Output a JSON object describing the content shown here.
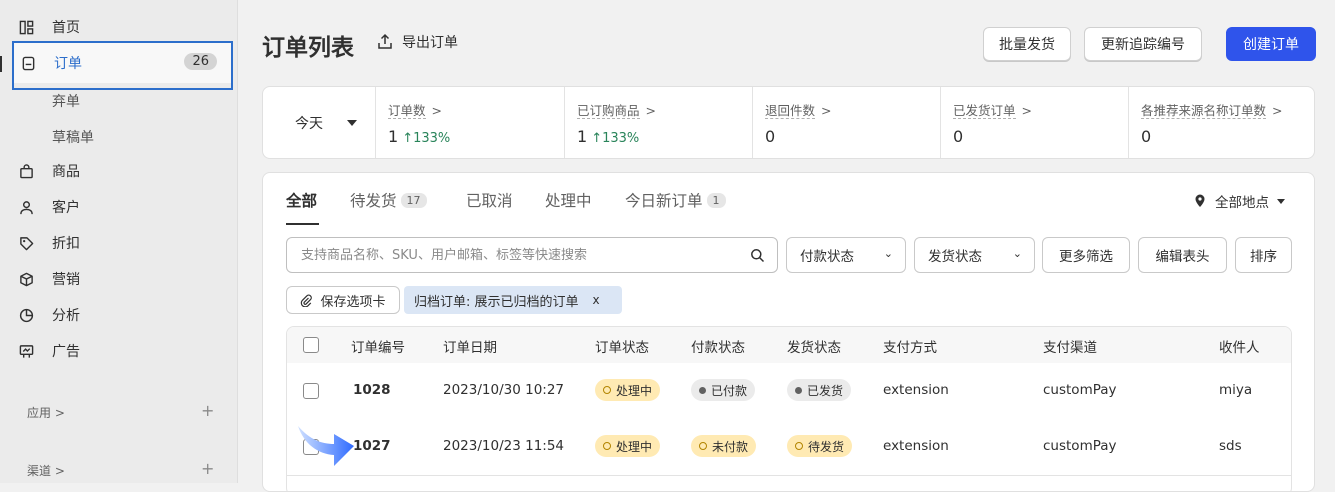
{
  "sidebar": {
    "home": "首页",
    "orders": "订单",
    "orders_count": "26",
    "abandoned": "弃单",
    "drafts": "草稿单",
    "products": "商品",
    "customers": "客户",
    "discounts": "折扣",
    "marketing": "营销",
    "analytics": "分析",
    "ads": "广告",
    "apps": "应用 >",
    "channels": "渠道 >"
  },
  "header": {
    "title": "订单列表",
    "export": "导出订单",
    "bulk_ship": "批量发货",
    "update_tracking": "更新追踪编号",
    "create_order": "创建订单"
  },
  "stats": {
    "period": "今天",
    "items": [
      {
        "label": "订单数",
        "value": "1",
        "delta": "133%"
      },
      {
        "label": "已订购商品",
        "value": "1",
        "delta": "133%"
      },
      {
        "label": "退回件数",
        "value": "0",
        "delta": ""
      },
      {
        "label": "已发货订单",
        "value": "0",
        "delta": ""
      },
      {
        "label": "各推荐来源名称订单数",
        "value": "0",
        "delta": ""
      }
    ]
  },
  "tabs": [
    {
      "label": "全部",
      "count": ""
    },
    {
      "label": "待发货",
      "count": "17"
    },
    {
      "label": "已取消",
      "count": ""
    },
    {
      "label": "处理中",
      "count": ""
    },
    {
      "label": "今日新订单",
      "count": "1"
    }
  ],
  "location": "全部地点",
  "filters": {
    "search_placeholder": "支持商品名称、SKU、用户邮箱、标签等快速搜索",
    "payment_status": "付款状态",
    "shipping_status": "发货状态",
    "more_filters": "更多筛选",
    "edit_columns": "编辑表头",
    "sort": "排序",
    "save_tab": "保存选项卡",
    "active_filter": "归档订单: 展示已归档的订单",
    "remove": "x"
  },
  "table": {
    "columns": [
      "订单编号",
      "订单日期",
      "订单状态",
      "付款状态",
      "发货状态",
      "支付方式",
      "支付渠道",
      "收件人"
    ],
    "rows": [
      {
        "id": "1028",
        "date": "2023/10/30 10:27",
        "order_status": "处理中",
        "payment": "已付款",
        "shipping": "已发货",
        "method": "extension",
        "channel": "customPay",
        "recipient": "miya"
      },
      {
        "id": "1027",
        "date": "2023/10/23 11:54",
        "order_status": "处理中",
        "payment": "未付款",
        "shipping": "待发货",
        "method": "extension",
        "channel": "customPay",
        "recipient": "sds"
      }
    ]
  },
  "colors": {
    "primary": "#2f54eb",
    "highlight_border": "#2c6ecb",
    "positive": "#29845a",
    "warning_pill": "#ffeab3",
    "neutral_pill": "#ebebeb"
  }
}
